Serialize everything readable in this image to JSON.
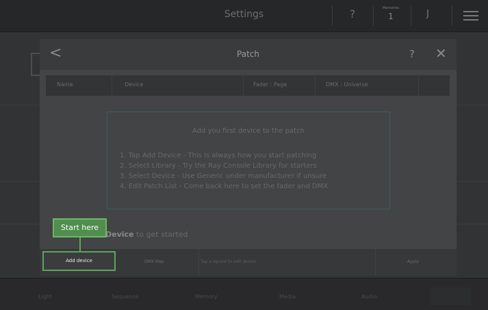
{
  "header": {
    "title": "Settings",
    "help_label": "?",
    "memories_label": "Memories",
    "memories_value": "1",
    "user_label": "J",
    "menu_icon": "hamburger-menu-icon"
  },
  "modal": {
    "back_label": "<",
    "title": "Patch",
    "help_label": "?",
    "close_label": "✕",
    "columns": [
      "Name",
      "Device",
      "Fader : Page",
      "DMX : Universe"
    ],
    "hint_title": "Add you first device to the patch",
    "steps": [
      "1. Tap Add Device - This is always how you start patching",
      "2. Select Library - Try the Ray Console Library for starters",
      "3. Select Device - Use Generic under manufacturer if unsure",
      "4. Edit Patch List - Come back here to set the fader and DMX"
    ],
    "get_started_bold": "Device",
    "get_started_rest": " to get started",
    "footer": {
      "add_device": "Add device",
      "dmx_map": "DMX Map",
      "tap_hint": "Tap a square to edit device",
      "apply": "Apply"
    }
  },
  "callout": {
    "label": "Start here",
    "color": "#5ca659"
  },
  "bottom_nav": [
    "Light",
    "Sequence",
    "Memory",
    "Media",
    "Audio"
  ]
}
